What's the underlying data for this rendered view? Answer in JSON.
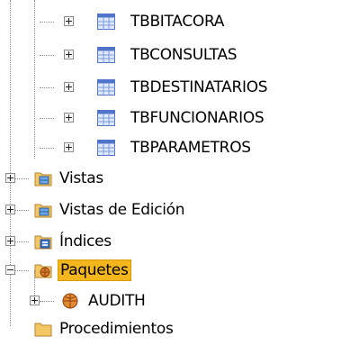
{
  "tree": {
    "tables": [
      {
        "label": "TBBITACORA"
      },
      {
        "label": "TBCONSULTAS"
      },
      {
        "label": "TBDESTINATARIOS"
      },
      {
        "label": "TBFUNCIONARIOS"
      },
      {
        "label": "TBPARAMETROS"
      }
    ],
    "nodes": {
      "vistas": {
        "label": "Vistas"
      },
      "vistas_edicion": {
        "label": "Vistas de Edición"
      },
      "indices": {
        "label": "Índices"
      },
      "paquetes": {
        "label": "Paquetes"
      },
      "audith": {
        "label": "AUDITH"
      },
      "procedimientos": {
        "label": "Procedimientos"
      }
    }
  },
  "icons": {
    "table": "table-icon",
    "view": "view-folder-icon",
    "index": "index-folder-icon",
    "package_folder": "package-folder-icon",
    "package": "package-icon"
  },
  "colors": {
    "selection": "#f3b61c",
    "folder": "#e8b84a",
    "table_blue": "#4f74c9"
  }
}
